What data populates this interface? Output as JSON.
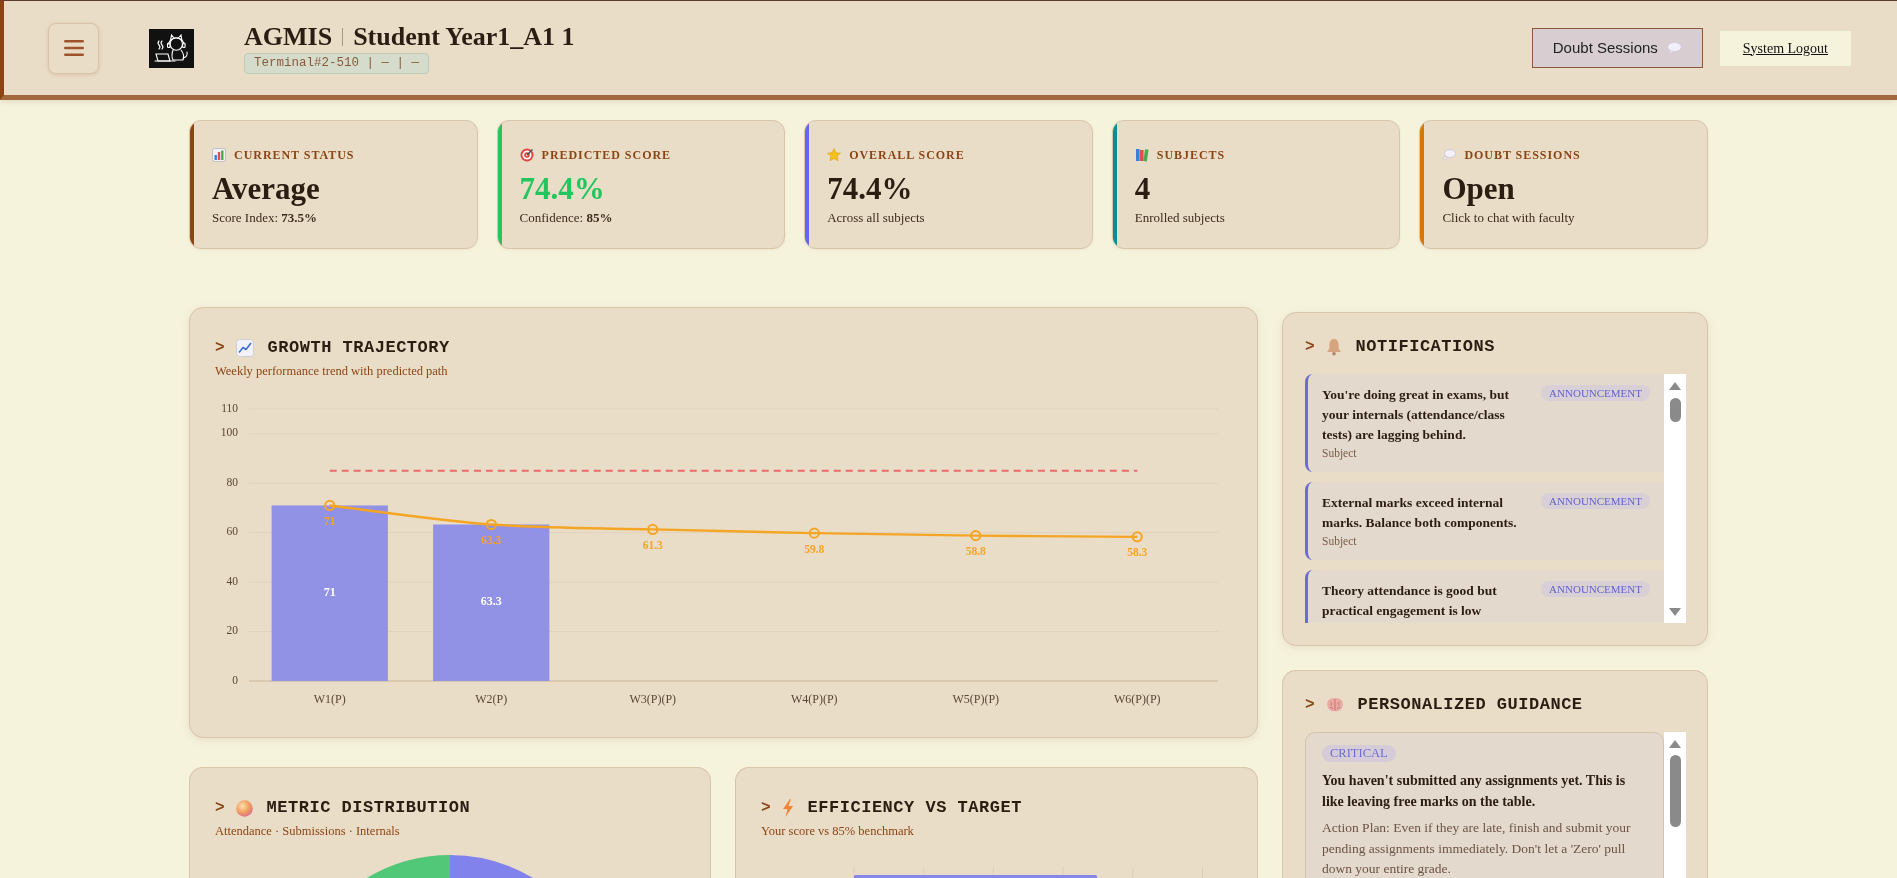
{
  "header": {
    "brand": "AGMIS",
    "title": "Student Year1_A1 1",
    "terminal": "Terminal#2-510 | — | —",
    "buttons": [
      {
        "kind": "primary",
        "label": "Doubt Sessions"
      },
      {
        "kind": "link",
        "label": "System Logout"
      }
    ]
  },
  "stats": [
    {
      "kind": "status",
      "label": "CURRENT STATUS",
      "value": "Average",
      "note": "Score Index: **73.5%**",
      "color": "#8b4513",
      "highlight": false
    },
    {
      "kind": "prediction",
      "label": "PREDICTED SCORE",
      "value": "74.4%",
      "note": "Confidence: **85%**",
      "color": "#22c55e",
      "highlight": true
    },
    {
      "kind": "score",
      "label": "OVERALL SCORE",
      "value": "74.4%",
      "note": "Across all subjects",
      "color": "#6366f1",
      "highlight": false
    },
    {
      "kind": "subjects",
      "label": "SUBJECTS",
      "value": "4",
      "note": "Enrolled subjects",
      "color": "#0e8a9a",
      "highlight": false
    },
    {
      "kind": "sessions",
      "label": "DOUBT SESSIONS",
      "value": "Open",
      "note": "Click to chat with faculty",
      "color": "#d97706",
      "highlight": false
    }
  ],
  "growth": {
    "prefix": ">",
    "title": "GROWTH TRAJECTORY",
    "subtitle": "Weekly performance trend with predicted path",
    "chart_data": {
      "type": "bar",
      "categories": [
        "W1(P)",
        "W2(P)",
        "W3(P)(P)",
        "W4(P)(P)",
        "W5(P)(P)",
        "W6(P)(P)"
      ],
      "series": [
        {
          "color": "#9191e6",
          "values": [
            71,
            63.3,
            null,
            null,
            null,
            null
          ],
          "value_labels": [
            "71",
            "63.3",
            null,
            null,
            null,
            null
          ]
        },
        {
          "type": "line",
          "color": "#f5a524",
          "marker": "o",
          "values": [
            71,
            63.3,
            61.3,
            59.8,
            58.8,
            58.3
          ],
          "value_labels": [
            "71",
            "63.3",
            "61.3",
            "59.8",
            "58.8",
            "58.3"
          ]
        },
        {
          "type": "line",
          "color": "#ec6a6a",
          "line_style": "dashed",
          "values": [
            85,
            85,
            85,
            85,
            85,
            85
          ]
        }
      ],
      "ylim": [
        0,
        110
      ],
      "yticks": [
        0,
        20,
        40,
        60,
        80,
        100,
        110
      ],
      "grid": true
    }
  },
  "notifications": {
    "prefix": ">",
    "title": "NOTIFICATIONS",
    "items": [
      {
        "text": "You're doing great in exams, but your internals (attendance/class tests) are lagging behind.",
        "tag": "ANNOUNCEMENT",
        "meta": "Subject"
      },
      {
        "text": "External marks exceed internal marks. Balance both components.",
        "tag": "ANNOUNCEMENT",
        "meta": "Subject"
      },
      {
        "text": "Theory attendance is good but practical engagement is low",
        "tag": "ANNOUNCEMENT"
      }
    ]
  },
  "guidance": {
    "prefix": ">",
    "title": "PERSONALIZED GUIDANCE",
    "items": [
      {
        "tag": "CRITICAL",
        "text": "You haven't submitted any assignments yet. This is like leaving free marks on the table.",
        "plan": "Action Plan: Even if they are late, finish and submit your pending assignments immediately. Don't let a 'Zero' pull down your entire grade."
      }
    ]
  },
  "distribution": {
    "prefix": ">",
    "title": "METRIC DISTRIBUTION",
    "subtitle": "Attendance · Submissions · Internals"
  },
  "efficiency": {
    "prefix": ">",
    "title": "EFFICIENCY VS TARGET",
    "subtitle": "Your score vs 85% benchmark"
  }
}
